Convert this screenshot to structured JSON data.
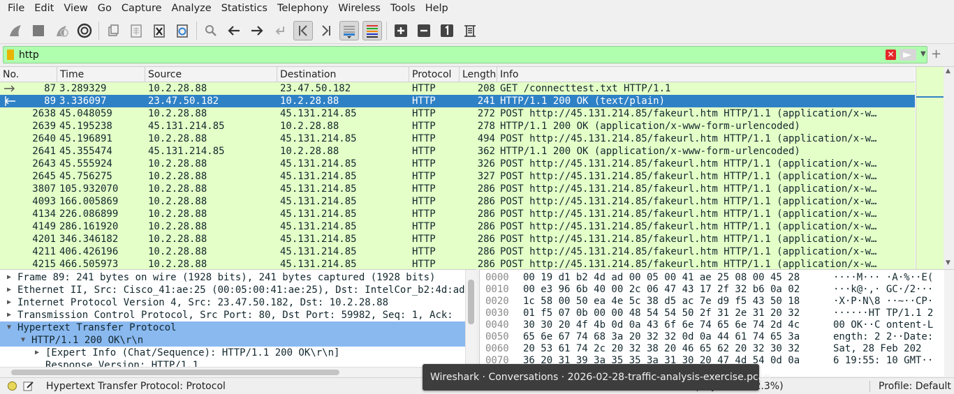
{
  "menu": [
    "File",
    "Edit",
    "View",
    "Go",
    "Capture",
    "Analyze",
    "Statistics",
    "Telephony",
    "Wireless",
    "Tools",
    "Help"
  ],
  "toolbar_icons": [
    "shark-fin-start-icon",
    "stop-square-icon",
    "restart-icon",
    "gear-options-icon",
    "open-file-icon",
    "file-grid-icon",
    "close-file-icon",
    "reload-icon",
    "search-icon",
    "arrow-left-icon",
    "arrow-right-icon",
    "jump-to-icon",
    "first-packet-icon",
    "last-packet-icon",
    "autoscroll-icon",
    "colorize-icon",
    "zoom-in-icon",
    "zoom-out-icon",
    "normal-size-icon",
    "resize-columns-icon"
  ],
  "filter": {
    "value": "http",
    "clear": "✕",
    "add": "+"
  },
  "columns": [
    "No.",
    "Time",
    "Source",
    "Destination",
    "Protocol",
    "Length",
    "Info"
  ],
  "packets": [
    {
      "no": "87",
      "time": "3.289329",
      "src": "10.2.28.88",
      "dst": "23.47.50.182",
      "proto": "HTTP",
      "len": "208",
      "info": "GET /connecttest.txt HTTP/1.1"
    },
    {
      "no": "89",
      "time": "3.336097",
      "src": "23.47.50.182",
      "dst": "10.2.28.88",
      "proto": "HTTP",
      "len": "241",
      "info": "HTTP/1.1 200 OK  (text/plain)"
    },
    {
      "no": "2638",
      "time": "45.048059",
      "src": "10.2.28.88",
      "dst": "45.131.214.85",
      "proto": "HTTP",
      "len": "272",
      "info": "POST http://45.131.214.85/fakeurl.htm HTTP/1.1  (application/x-w…"
    },
    {
      "no": "2639",
      "time": "45.195238",
      "src": "45.131.214.85",
      "dst": "10.2.28.88",
      "proto": "HTTP",
      "len": "278",
      "info": "HTTP/1.1 200 OK  (application/x-www-form-urlencoded)"
    },
    {
      "no": "2640",
      "time": "45.196891",
      "src": "10.2.28.88",
      "dst": "45.131.214.85",
      "proto": "HTTP",
      "len": "494",
      "info": "POST http://45.131.214.85/fakeurl.htm HTTP/1.1  (application/x-w…"
    },
    {
      "no": "2641",
      "time": "45.355474",
      "src": "45.131.214.85",
      "dst": "10.2.28.88",
      "proto": "HTTP",
      "len": "362",
      "info": "HTTP/1.1 200 OK  (application/x-www-form-urlencoded)"
    },
    {
      "no": "2643",
      "time": "45.555924",
      "src": "10.2.28.88",
      "dst": "45.131.214.85",
      "proto": "HTTP",
      "len": "326",
      "info": "POST http://45.131.214.85/fakeurl.htm HTTP/1.1  (application/x-w…"
    },
    {
      "no": "2645",
      "time": "45.756275",
      "src": "10.2.28.88",
      "dst": "45.131.214.85",
      "proto": "HTTP",
      "len": "327",
      "info": "POST http://45.131.214.85/fakeurl.htm HTTP/1.1  (application/x-w…"
    },
    {
      "no": "3807",
      "time": "105.932070",
      "src": "10.2.28.88",
      "dst": "45.131.214.85",
      "proto": "HTTP",
      "len": "286",
      "info": "POST http://45.131.214.85/fakeurl.htm HTTP/1.1  (application/x-w…"
    },
    {
      "no": "4093",
      "time": "166.005869",
      "src": "10.2.28.88",
      "dst": "45.131.214.85",
      "proto": "HTTP",
      "len": "286",
      "info": "POST http://45.131.214.85/fakeurl.htm HTTP/1.1  (application/x-w…"
    },
    {
      "no": "4134",
      "time": "226.086899",
      "src": "10.2.28.88",
      "dst": "45.131.214.85",
      "proto": "HTTP",
      "len": "286",
      "info": "POST http://45.131.214.85/fakeurl.htm HTTP/1.1  (application/x-w…"
    },
    {
      "no": "4149",
      "time": "286.161920",
      "src": "10.2.28.88",
      "dst": "45.131.214.85",
      "proto": "HTTP",
      "len": "286",
      "info": "POST http://45.131.214.85/fakeurl.htm HTTP/1.1  (application/x-w…"
    },
    {
      "no": "4201",
      "time": "346.346182",
      "src": "10.2.28.88",
      "dst": "45.131.214.85",
      "proto": "HTTP",
      "len": "286",
      "info": "POST http://45.131.214.85/fakeurl.htm HTTP/1.1  (application/x-w…"
    },
    {
      "no": "4211",
      "time": "406.426196",
      "src": "10.2.28.88",
      "dst": "45.131.214.85",
      "proto": "HTTP",
      "len": "286",
      "info": "POST http://45.131.214.85/fakeurl.htm HTTP/1.1  (application/x-w…"
    },
    {
      "no": "4215",
      "time": "466.505973",
      "src": "10.2.28.88",
      "dst": "45.131.214.85",
      "proto": "HTTP",
      "len": "286",
      "info": "POST http://45.131.214.85/fakeurl.htm HTTP/1.1  (application/x-w…"
    }
  ],
  "selected_packet_index": 1,
  "details": [
    {
      "text": "Frame 89: 241 bytes on wire (1928 bits), 241 bytes captured (1928 bits)",
      "level": 0,
      "expanded": false,
      "selected": false
    },
    {
      "text": "Ethernet II, Src: Cisco_41:ae:25 (00:05:00:41:ae:25), Dst: IntelCor_b2:4d:ad",
      "level": 0,
      "expanded": false,
      "selected": false
    },
    {
      "text": "Internet Protocol Version 4, Src: 23.47.50.182, Dst: 10.2.28.88",
      "level": 0,
      "expanded": false,
      "selected": false
    },
    {
      "text": "Transmission Control Protocol, Src Port: 80, Dst Port: 59982, Seq: 1, Ack:",
      "level": 0,
      "expanded": false,
      "selected": false
    },
    {
      "text": "Hypertext Transfer Protocol",
      "level": 0,
      "expanded": true,
      "selected": true
    },
    {
      "text": "HTTP/1.1 200 OK\\r\\n",
      "level": 1,
      "expanded": true,
      "selected": true
    },
    {
      "text": "[Expert Info (Chat/Sequence): HTTP/1.1 200 OK\\r\\n]",
      "level": 2,
      "expanded": false,
      "selected": false
    },
    {
      "text": "Response Version: HTTP/1.1",
      "level": 2,
      "expanded": null,
      "selected": false
    }
  ],
  "bytes": [
    {
      "offset": "0000",
      "hex": "00 19 d1 b2 4d ad 00 05  00 41 ae 25 08 00 45 28",
      "ascii": "····M··· ·A·%··E("
    },
    {
      "offset": "0010",
      "hex": "00 e3 96 6b 40 00 2c 06  47 43 17 2f 32 b6 0a 02",
      "ascii": "···k@·,· GC·/2···"
    },
    {
      "offset": "0020",
      "hex": "1c 58 00 50 ea 4e 5c 38  d5 ac 7e d9 f5 43 50 18",
      "ascii": "·X·P·N\\8 ··~··CP·"
    },
    {
      "offset": "0030",
      "hex": "01 f5 07 0b 00 00 48 54  54 50 2f 31 2e 31 20 32",
      "ascii": "······HT TP/1.1 2"
    },
    {
      "offset": "0040",
      "hex": "30 30 20 4f 4b 0d 0a 43  6f 6e 74 65 6e 74 2d 4c",
      "ascii": "00 OK··C ontent-L"
    },
    {
      "offset": "0050",
      "hex": "65 6e 67 74 68 3a 20 32  32 0d 0a 44 61 74 65 3a",
      "ascii": "ength: 2 2··Date:"
    },
    {
      "offset": "0060",
      "hex": "20 53 61 74 2c 20 32 38  20 46 65 62 20 32 30 32",
      "ascii": " Sat, 28  Feb 202"
    },
    {
      "offset": "0070",
      "hex": "36 20 31 39 3a 35 35 3a  31 30 20 47 4d 54 0d 0a",
      "ascii": "6 19:55: 10 GMT··"
    }
  ],
  "status": {
    "text": "Hypertext Transfer Protocol: Protocol",
    "packets": "Packets: 4… · Displayed: 15 (2.3%)",
    "profile": "Profile: Default"
  },
  "tooltip": "Wireshark · Conversations · 2026-02-28-traffic-analysis-exercise.pcap",
  "colors": {
    "http_row": "#e4ffc7",
    "selected_row": "#2f81c6",
    "filter_valid": "#afffaf",
    "detail_selected": "#8ab9f0"
  }
}
